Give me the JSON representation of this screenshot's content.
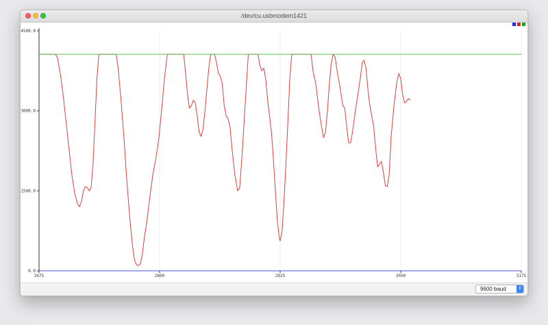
{
  "window": {
    "title": "/dev/cu.usbmodem1421"
  },
  "legend": [
    "blue",
    "red",
    "green"
  ],
  "colors": {
    "red_series": "#e23b3b",
    "green_series": "#58c458",
    "blue_series": "#5050dc",
    "axis": "#333333"
  },
  "footer": {
    "baud_rate": "9600 baud"
  },
  "chart_data": {
    "type": "line",
    "xlim": [
      2675,
      3175
    ],
    "ylim": [
      0,
      4500
    ],
    "x_ticks": [
      "2675",
      "2800",
      "2925",
      "3050",
      "3175"
    ],
    "y_ticks": [
      "4500.0",
      "3000.0",
      "1500.0",
      "0.0"
    ],
    "series": [
      {
        "color": "red",
        "points": [
          [
            2675,
            4060
          ],
          [
            2692,
            4060
          ],
          [
            2694,
            4000
          ],
          [
            2697,
            3700
          ],
          [
            2700,
            3300
          ],
          [
            2703,
            2800
          ],
          [
            2706,
            2300
          ],
          [
            2709,
            1800
          ],
          [
            2712,
            1450
          ],
          [
            2715,
            1250
          ],
          [
            2717,
            1200
          ],
          [
            2719,
            1300
          ],
          [
            2721,
            1500
          ],
          [
            2723,
            1580
          ],
          [
            2725,
            1560
          ],
          [
            2727,
            1500
          ],
          [
            2729,
            1560
          ],
          [
            2731,
            2000
          ],
          [
            2733,
            2800
          ],
          [
            2735,
            3600
          ],
          [
            2737,
            4060
          ],
          [
            2755,
            4060
          ],
          [
            2757,
            3800
          ],
          [
            2760,
            3200
          ],
          [
            2763,
            2500
          ],
          [
            2766,
            1700
          ],
          [
            2769,
            1000
          ],
          [
            2772,
            450
          ],
          [
            2774,
            200
          ],
          [
            2776,
            110
          ],
          [
            2778,
            100
          ],
          [
            2780,
            130
          ],
          [
            2782,
            300
          ],
          [
            2784,
            600
          ],
          [
            2787,
            950
          ],
          [
            2790,
            1400
          ],
          [
            2793,
            1800
          ],
          [
            2796,
            2100
          ],
          [
            2799,
            2450
          ],
          [
            2802,
            3000
          ],
          [
            2805,
            3600
          ],
          [
            2808,
            4060
          ],
          [
            2825,
            4060
          ],
          [
            2827,
            3700
          ],
          [
            2829,
            3300
          ],
          [
            2831,
            3050
          ],
          [
            2833,
            3100
          ],
          [
            2835,
            3200
          ],
          [
            2837,
            3150
          ],
          [
            2839,
            2900
          ],
          [
            2841,
            2600
          ],
          [
            2843,
            2520
          ],
          [
            2845,
            2650
          ],
          [
            2847,
            3000
          ],
          [
            2849,
            3400
          ],
          [
            2851,
            3800
          ],
          [
            2853,
            4060
          ],
          [
            2857,
            4060
          ],
          [
            2859,
            3900
          ],
          [
            2861,
            3700
          ],
          [
            2863,
            3650
          ],
          [
            2865,
            3500
          ],
          [
            2867,
            3100
          ],
          [
            2869,
            2900
          ],
          [
            2871,
            2850
          ],
          [
            2873,
            2700
          ],
          [
            2875,
            2300
          ],
          [
            2878,
            1800
          ],
          [
            2881,
            1500
          ],
          [
            2883,
            1550
          ],
          [
            2886,
            2300
          ],
          [
            2889,
            3200
          ],
          [
            2892,
            4060
          ],
          [
            2902,
            4060
          ],
          [
            2904,
            3850
          ],
          [
            2906,
            3750
          ],
          [
            2908,
            3800
          ],
          [
            2910,
            3600
          ],
          [
            2912,
            3200
          ],
          [
            2914,
            2900
          ],
          [
            2916,
            2600
          ],
          [
            2918,
            2100
          ],
          [
            2920,
            1500
          ],
          [
            2922,
            950
          ],
          [
            2924,
            620
          ],
          [
            2925,
            560
          ],
          [
            2927,
            750
          ],
          [
            2929,
            1300
          ],
          [
            2931,
            2000
          ],
          [
            2933,
            2800
          ],
          [
            2935,
            3600
          ],
          [
            2937,
            4060
          ],
          [
            2957,
            4060
          ],
          [
            2959,
            3750
          ],
          [
            2962,
            3500
          ],
          [
            2965,
            3050
          ],
          [
            2968,
            2700
          ],
          [
            2970,
            2500
          ],
          [
            2972,
            2600
          ],
          [
            2974,
            3000
          ],
          [
            2976,
            3500
          ],
          [
            2978,
            3900
          ],
          [
            2980,
            4060
          ],
          [
            2982,
            4000
          ],
          [
            2984,
            3750
          ],
          [
            2987,
            3450
          ],
          [
            2990,
            3100
          ],
          [
            2992,
            3050
          ],
          [
            2994,
            2700
          ],
          [
            2996,
            2400
          ],
          [
            2998,
            2400
          ],
          [
            3000,
            2600
          ],
          [
            3003,
            3000
          ],
          [
            3006,
            3350
          ],
          [
            3008,
            3600
          ],
          [
            3010,
            3900
          ],
          [
            3012,
            3950
          ],
          [
            3014,
            3800
          ],
          [
            3016,
            3400
          ],
          [
            3018,
            3100
          ],
          [
            3020,
            2900
          ],
          [
            3022,
            2700
          ],
          [
            3024,
            2300
          ],
          [
            3026,
            1950
          ],
          [
            3028,
            2000
          ],
          [
            3030,
            2050
          ],
          [
            3032,
            1850
          ],
          [
            3034,
            1600
          ],
          [
            3036,
            1580
          ],
          [
            3038,
            1800
          ],
          [
            3040,
            2500
          ],
          [
            3043,
            3100
          ],
          [
            3046,
            3550
          ],
          [
            3048,
            3700
          ],
          [
            3050,
            3600
          ],
          [
            3052,
            3300
          ],
          [
            3054,
            3150
          ],
          [
            3056,
            3180
          ],
          [
            3058,
            3230
          ],
          [
            3060,
            3200
          ]
        ]
      },
      {
        "color": "green",
        "points": [
          [
            2675,
            4060
          ],
          [
            3175,
            4060
          ]
        ]
      },
      {
        "color": "blue",
        "points": [
          [
            2675,
            0
          ],
          [
            3175,
            0
          ]
        ]
      }
    ]
  }
}
